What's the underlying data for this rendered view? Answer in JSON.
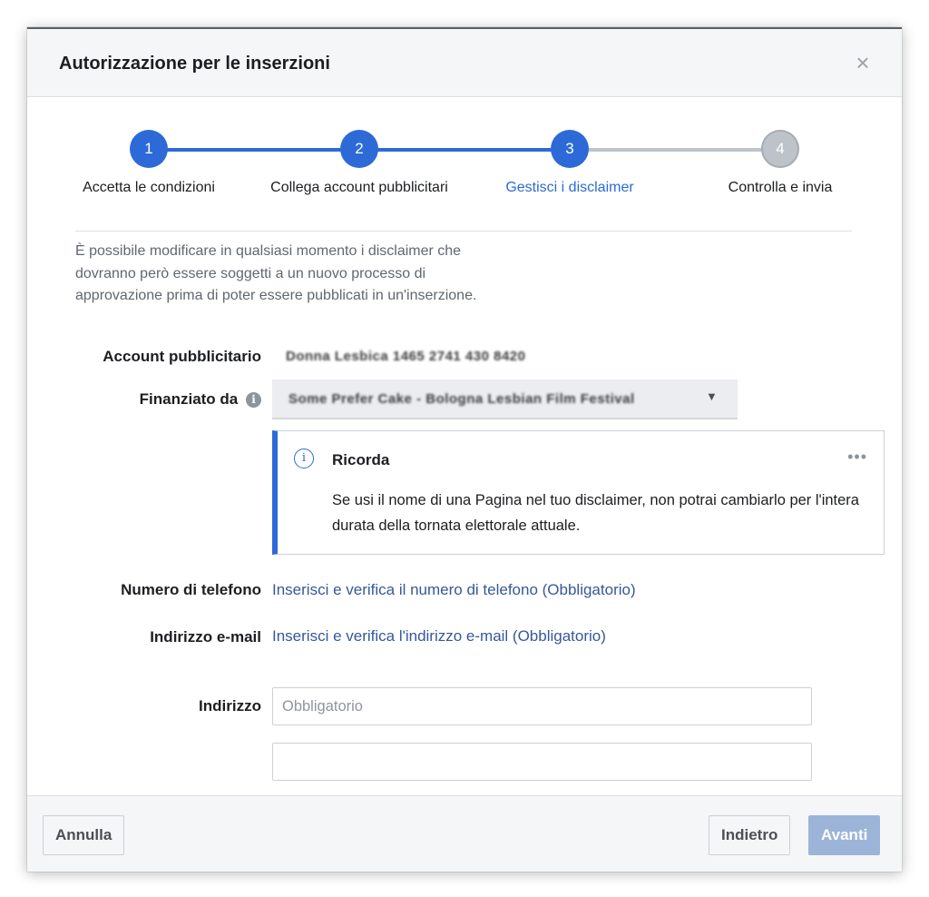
{
  "dialog": {
    "title": "Autorizzazione per le inserzioni",
    "close_icon": "close-icon",
    "close_glyph": "×"
  },
  "stepper": {
    "steps": [
      {
        "number": "1",
        "label": "Accetta le condizioni",
        "state": "completed"
      },
      {
        "number": "2",
        "label": "Collega account pubblicitari",
        "state": "completed"
      },
      {
        "number": "3",
        "label": "Gestisci i disclaimer",
        "state": "active"
      },
      {
        "number": "4",
        "label": "Controlla e invia",
        "state": "pending"
      }
    ]
  },
  "intro_text": "È possibile modificare in qualsiasi momento i disclaimer che dovranno però essere soggetti a un nuovo processo di approvazione prima di poter essere pubblicati in un'inserzione.",
  "form": {
    "ad_account": {
      "label": "Account pubblicitario",
      "value": "Donna Lesbica 1465 2741 430 8420"
    },
    "funded_by": {
      "label": "Finanziato da",
      "info_icon": "info-icon",
      "info_glyph": "i",
      "selected": "Some Prefer Cake - Bologna Lesbian Film Festival",
      "caret_glyph": "▼"
    },
    "notice": {
      "icon": "info-circle-icon",
      "icon_glyph": "i",
      "title": "Ricorda",
      "more_glyph": "•••",
      "body": "Se usi il nome di una Pagina nel tuo disclaimer, non potrai cambiarlo per l'intera durata della tornata elettorale attuale."
    },
    "phone": {
      "label": "Numero di telefono",
      "link": "Inserisci e verifica il numero di telefono (Obbligatorio)"
    },
    "email": {
      "label": "Indirizzo e-mail",
      "link": "Inserisci e verifica l'indirizzo e-mail (Obbligatorio)"
    },
    "address": {
      "label": "Indirizzo",
      "line1_placeholder": "Obbligatorio",
      "line1_value": "",
      "line2_placeholder": "",
      "line2_value": ""
    }
  },
  "footer": {
    "cancel_label": "Annulla",
    "back_label": "Indietro",
    "next_label": "Avanti"
  },
  "colors": {
    "accent": "#2d6ad8",
    "link": "#365899",
    "pending": "#bec3c9",
    "primary_disabled": "#9cb4d8"
  }
}
